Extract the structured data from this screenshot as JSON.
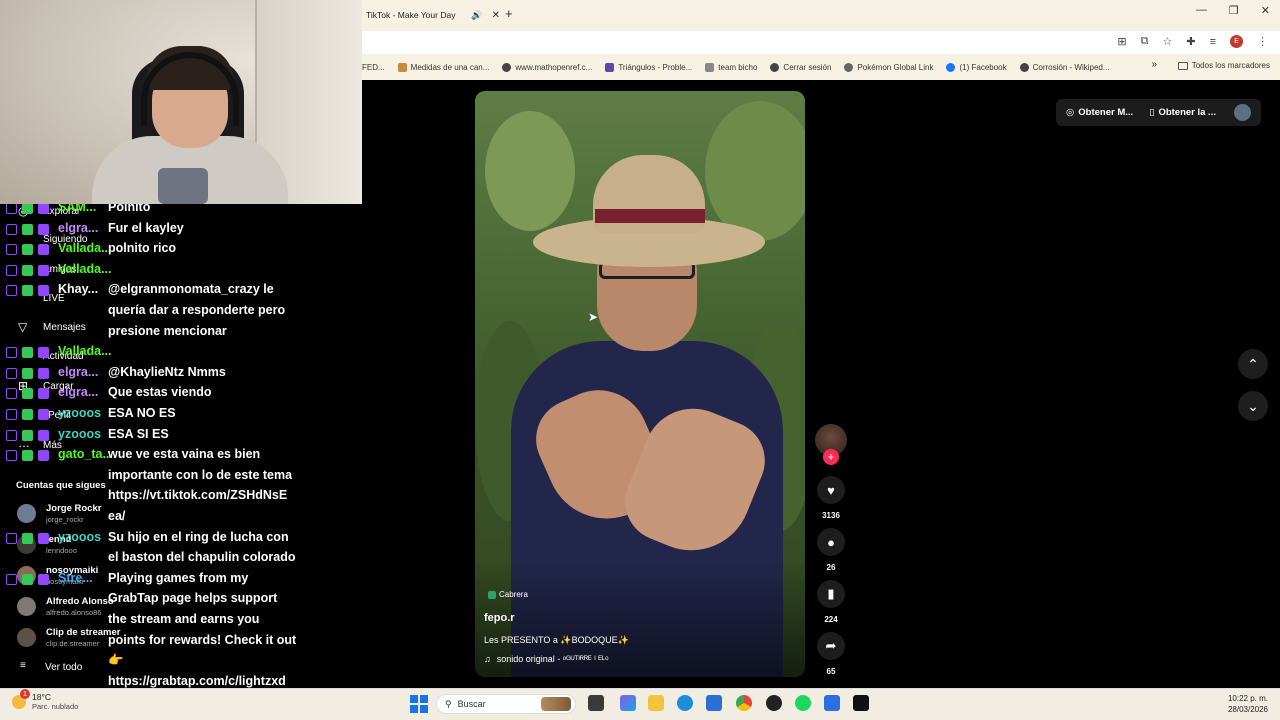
{
  "browser": {
    "tab_title": "TikTok - Make Your Day",
    "bookmarks": [
      "FED...",
      "Medidas de una can...",
      "www.mathopenref.c...",
      "Triángulos - Proble...",
      "team bicho",
      "Cerrar sesión",
      "Pokémon Global Link",
      "(1) Facebook",
      "Corrosión - Wikiped..."
    ],
    "all_bookmarks": "Todos los marcadores",
    "profile_initial": "E"
  },
  "tiktok": {
    "top_pill": {
      "get_coins": "Obtener M...",
      "get_app": "Obtener la ..."
    },
    "video": {
      "location": "Cabrera",
      "author": "fepo.r",
      "caption": "Les PRESENTO a ✨BODOQUE✨",
      "sound": "sonido original - ᵒᴳᵁᵀᴵᴿᴿᴱ ᴵ ᴱᴸᵒ"
    },
    "counts": {
      "likes": "3136",
      "comments": "26",
      "saves": "224",
      "shares": "65"
    }
  },
  "left_nav": {
    "explore": "Explorar",
    "following": "Siguiendo",
    "friends": "Amigos",
    "live": "LIVE",
    "messages": "Mensajes",
    "activity": "Actividad",
    "upload": "Cargar",
    "profile": "Perfil",
    "more": "Más",
    "followed_title": "Cuentas que sigues",
    "followed": [
      {
        "name": "Jorge Rockr",
        "handle": "jorge_rockr"
      },
      {
        "name": "lennd",
        "handle": "lenndooo"
      },
      {
        "name": "nosoymaiki",
        "handle": "nosoymaiki"
      },
      {
        "name": "Alfredo Alonso",
        "handle": "alfredo.alonso86"
      },
      {
        "name": "Clip de streamer",
        "handle": "clip.de.streamer"
      }
    ],
    "see_all": "Ver todo"
  },
  "chat": {
    "messages": [
      {
        "user": "SAM...",
        "color": "#53fc18",
        "text": "Poinito"
      },
      {
        "user": "elgra...",
        "color": "#c58af9",
        "text": "Fur el kayley"
      },
      {
        "user": "Vallada...",
        "color": "#53fc18",
        "text": "polnito rico"
      },
      {
        "user": "Vallada...",
        "color": "#53fc18",
        "text": ""
      },
      {
        "user": "Khay...",
        "color": "#ffffff",
        "text": "@elgranmonomata_crazy le"
      },
      {
        "user": "",
        "color": "#ffffff",
        "text": "quería dar a responderte pero"
      },
      {
        "user": "",
        "color": "#ffffff",
        "text": "presione mencionar"
      },
      {
        "user": "Vallada...",
        "color": "#53fc18",
        "text": ""
      },
      {
        "user": "elgra...",
        "color": "#c58af9",
        "text": "@KhaylieNtz Nmms"
      },
      {
        "user": "elgra...",
        "color": "#c58af9",
        "text": "Que estas viendo"
      },
      {
        "user": "yzooos",
        "color": "#3fd2c7",
        "text": "ESA NO ES"
      },
      {
        "user": "yzooos",
        "color": "#3fd2c7",
        "text": "ESA SI ES"
      },
      {
        "user": "gato_ta...",
        "color": "#53fc18",
        "text": "wue ve esta vaina es bien"
      },
      {
        "user": "",
        "color": "#ffffff",
        "text": "importante con lo de este tema"
      },
      {
        "user": "",
        "color": "#ffffff",
        "text": "https://vt.tiktok.com/ZSHdNsE"
      },
      {
        "user": "",
        "color": "#ffffff",
        "text": "ea/"
      },
      {
        "user": "yzooos",
        "color": "#3fd2c7",
        "text": "Su hijo en el ring de lucha con"
      },
      {
        "user": "",
        "color": "#ffffff",
        "text": "el baston del chapulin colorado"
      },
      {
        "user": "Stre...",
        "color": "#3fa9f5",
        "text": "Playing games from my"
      },
      {
        "user": "",
        "color": "#ffffff",
        "text": "GrabTap page helps support"
      },
      {
        "user": "",
        "color": "#ffffff",
        "text": "the stream and earns you"
      },
      {
        "user": "",
        "color": "#ffffff",
        "text": "points for rewards! Check it out"
      },
      {
        "user": "",
        "color": "#ffffff",
        "text": "👉"
      },
      {
        "user": "",
        "color": "#ffffff",
        "text": "https://grabtap.com/c/lightzxd"
      }
    ]
  },
  "taskbar": {
    "temperature": "18°C",
    "weather": "Parc. nublado",
    "weather_badge": "1",
    "search": "Buscar",
    "time": "10:22 p. m.",
    "date": "28/03/2026"
  }
}
